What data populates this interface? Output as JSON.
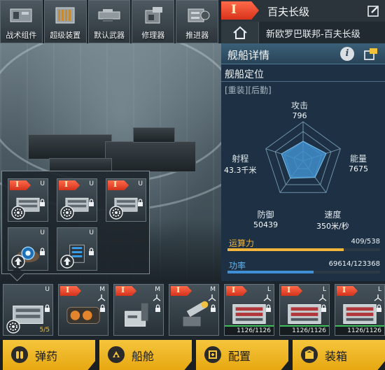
{
  "top_tabs": [
    {
      "label": "战术组件",
      "icon": "tactical-component-icon"
    },
    {
      "label": "超级装置",
      "icon": "super-device-icon"
    },
    {
      "label": "默认武器",
      "icon": "default-weapon-icon"
    },
    {
      "label": "修理器",
      "icon": "repairer-icon"
    },
    {
      "label": "推进器",
      "icon": "thruster-icon"
    }
  ],
  "header": {
    "rank": "I",
    "ship_name": "百夫长级",
    "faction": "新欧罗巴联邦-百夫长级"
  },
  "panel": {
    "title": "舰船详情",
    "section": "舰船定位",
    "roles": "[重装][后勤]",
    "stats": {
      "attack": {
        "label": "攻击",
        "value": "796"
      },
      "capacity": {
        "label": "能量",
        "value": "7675"
      },
      "speed": {
        "label": "速度",
        "value": "350米/秒"
      },
      "defense": {
        "label": "防御",
        "value": "50439"
      },
      "range": {
        "label": "射程",
        "value": "43.3千米"
      }
    },
    "compute": {
      "label": "运算力",
      "value": "409/538",
      "fraction": 0.76,
      "color": "#f0b53a"
    },
    "power": {
      "label": "功率",
      "value": "69614/123368",
      "fraction": 0.564,
      "color": "#3f8fd6"
    }
  },
  "popup_slots": [
    {
      "rank": "I",
      "size": "U",
      "kind": "module"
    },
    {
      "rank": "I",
      "size": "U",
      "kind": "module"
    },
    {
      "rank": "I",
      "size": "U",
      "kind": "module"
    },
    {
      "rank": "",
      "size": "U",
      "kind": "orb"
    },
    {
      "rank": "",
      "size": "U",
      "kind": "cell"
    }
  ],
  "strip_slots": [
    {
      "rank": "",
      "size": "U",
      "kind": "module",
      "count": "5/5"
    },
    {
      "rank": "I",
      "size": "M",
      "kind": "engine"
    },
    {
      "rank": "I",
      "size": "M",
      "kind": "turret"
    },
    {
      "rank": "I",
      "size": "M",
      "kind": "cannon"
    },
    {
      "rank": "I",
      "size": "L",
      "kind": "hangar",
      "hp": "1126/1126"
    },
    {
      "rank": "I",
      "size": "L",
      "kind": "hangar",
      "hp": "1126/1126"
    },
    {
      "rank": "I",
      "size": "L",
      "kind": "hangar",
      "hp": "1126/1126"
    }
  ],
  "bottom_nav": [
    {
      "label": "弹药",
      "icon": "ammo-icon"
    },
    {
      "label": "船舱",
      "icon": "cabin-icon"
    },
    {
      "label": "配置",
      "icon": "config-icon"
    },
    {
      "label": "装箱",
      "icon": "crate-icon"
    }
  ],
  "colors": {
    "accent": "#f5c53c",
    "rank_red": "#e24a2d",
    "panel_blue": "#294458"
  }
}
